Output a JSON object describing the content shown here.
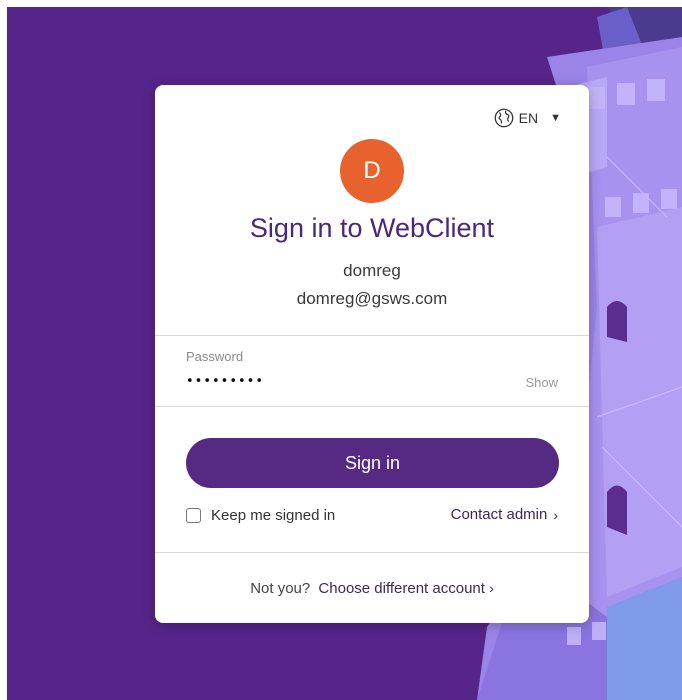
{
  "colors": {
    "background": "#56258a",
    "brand_purple": "#562983",
    "title_purple": "#4a2878",
    "avatar_orange": "#e8622e"
  },
  "language": {
    "icon": "globe-icon",
    "code": "EN",
    "caret": "▼"
  },
  "account": {
    "avatar_initial": "D",
    "name": "domreg",
    "email": "domreg@gsws.com"
  },
  "heading": "Sign in to WebClient",
  "password": {
    "label": "Password",
    "value": "•••••••••",
    "show_label": "Show"
  },
  "signin_button": "Sign in",
  "keep_signed_in": {
    "label": "Keep me signed in",
    "checked": false
  },
  "contact_admin": {
    "label": "Contact admin",
    "chevron": "›"
  },
  "footer": {
    "not_you": "Not you?",
    "choose_account": "Choose different account",
    "chevron": "›"
  }
}
